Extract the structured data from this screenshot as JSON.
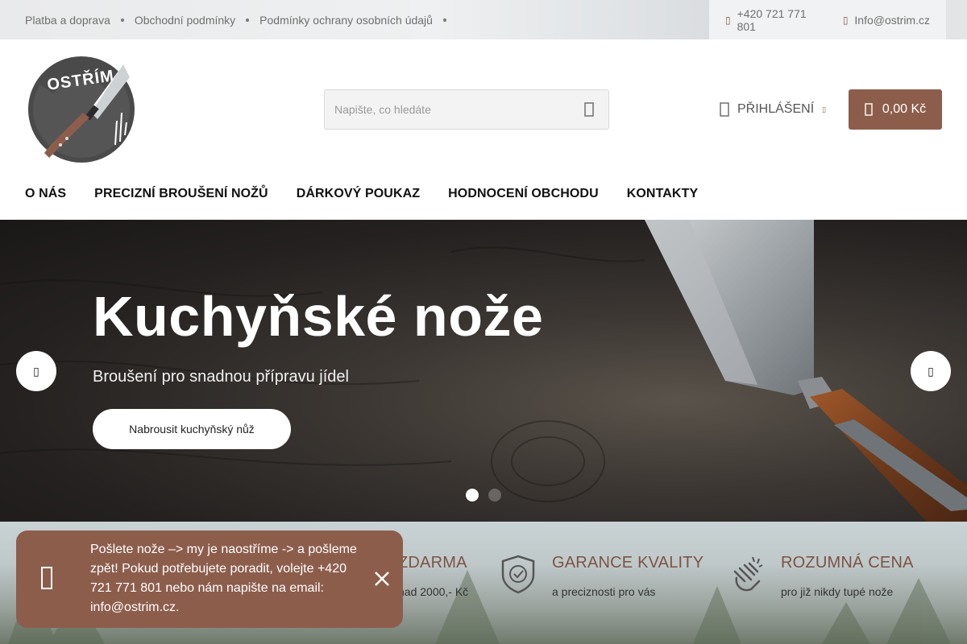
{
  "topbar": {
    "links": [
      "Platba a doprava",
      "Obchodní podmínky",
      "Podmínky ochrany osobních údajů"
    ],
    "phone": "+420 721 771 801",
    "email": "Info@ostrim.cz"
  },
  "logo": {
    "text": "OSTŘÍM"
  },
  "search": {
    "placeholder": "Napište, co hledáte"
  },
  "login": {
    "label": "PŘIHLÁŠENÍ"
  },
  "cart": {
    "total": "0,00 Kč"
  },
  "nav": [
    "O NÁS",
    "PRECIZNÍ BROUŠENÍ NOŽŮ",
    "DÁRKOVÝ POUKAZ",
    "HODNOCENÍ OBCHODU",
    "KONTAKTY"
  ],
  "hero": {
    "title": "Kuchyňské nože",
    "subtitle": "Broušení pro snadnou přípravu jídel",
    "cta": "Nabrousit kuchyňský nůž",
    "active_slide": 1,
    "slide_count": 2
  },
  "benefits": [
    {
      "title": "ZDARMA",
      "subtitle": "nad 2000,- Kč",
      "icon": "truck-icon"
    },
    {
      "title": "GARANCE KVALITY",
      "subtitle": "a preciznosti pro vás",
      "icon": "shield-check-icon"
    },
    {
      "title": "ROZUMNÁ CENA",
      "subtitle": "pro již nikdy tupé nože",
      "icon": "hand-icon"
    }
  ],
  "notice": {
    "text": "Pošlete nože –> my je naostříme -> a pošleme zpět! Pokud potřebujete poradit, volejte +420 721 771 801 nebo nám napište na email: info@ostrim.cz."
  },
  "colors": {
    "brand": "#8d5d4c",
    "accent_text": "#7c5345"
  }
}
